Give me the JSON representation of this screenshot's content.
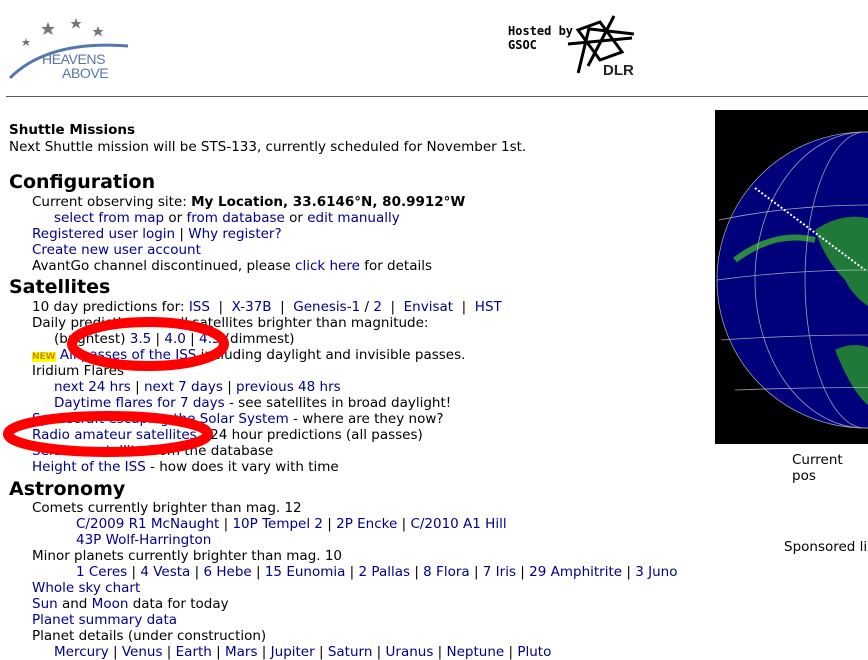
{
  "header": {
    "logo_line1": "HEAVENS",
    "logo_line2": "ABOVE",
    "hosted_by": "Hosted by GSOC",
    "dlr": "DLR"
  },
  "shuttle": {
    "heading": "Shuttle Missions",
    "text": "Next Shuttle mission will be STS-133, currently scheduled for November 1st."
  },
  "configuration": {
    "heading": "Configuration",
    "site_prefix": "Current observing site: ",
    "site_value": "My Location, 33.6146°N, 80.9912°W",
    "select_from_map": "select from map",
    "or1": " or ",
    "from_database": "from database",
    "or2": " or ",
    "edit_manually": "edit manually",
    "registered_login": "Registered user login",
    "sep": " | ",
    "why_register": "Why register?",
    "create_account": "Create new user account",
    "avantgo_prefix": "AvantGo channel discontinued, please ",
    "click_here": "click here",
    "avantgo_suffix": " for details"
  },
  "satellites": {
    "heading": "Satellites",
    "ten_day_prefix": "10 day predictions for: ",
    "iss": "ISS",
    "x37b": "X-37B",
    "genesis1": "Genesis-1",
    "slash": " / ",
    "genesis2": "2",
    "envisat": "Envisat",
    "hst": "HST",
    "daily_text": "Daily predictions for all satellites brighter than magnitude:",
    "brightest": "(brightest)",
    "mag35": "3.5",
    "mag40": "4.0",
    "mag45": "4.5",
    "dimmest": " (dimmest)",
    "new_badge": "NEW",
    "all_passes_iss": "All passes of the ISS",
    "all_passes_suffix": " including daylight and invisible passes.",
    "iridium": "Iridium Flares",
    "next24": "next 24 hrs",
    "next7": "next 7 days",
    "prev48": "previous 48 hrs",
    "daytime_flares": "Daytime flares for 7 days",
    "daytime_suffix": " - see satellites in broad daylight!",
    "spacecraft": "Spacecraft escaping",
    "solar_system": "the Solar System",
    "solar_suffix": " - where are they now?",
    "radio": "Radio amateur satellites",
    "radio_suffix": " - 24 hour predictions (all passes)",
    "select_sat": "Select",
    "select_sat_suffix": " a satellite from the database",
    "height_iss": "Height of the ISS",
    "height_suffix": " - how does it vary with time"
  },
  "astronomy": {
    "heading": "Astronomy",
    "comets_text": "Comets currently brighter than mag. 12",
    "comets": [
      "C/2009 R1 McNaught",
      "10P Tempel 2",
      "2P Encke",
      "C/2010 A1 Hill"
    ],
    "comet_extra": "43P Wolf-Harrington",
    "minor_text": "Minor planets currently brighter than mag. 10",
    "minor": [
      "1 Ceres",
      "4 Vesta",
      "6 Hebe",
      "15 Eunomia",
      "2 Pallas",
      "8 Flora",
      "7 Iris",
      "29 Amphitrite",
      "3 Juno"
    ],
    "whole_sky": "Whole sky chart",
    "sun": "Sun",
    "and": " and ",
    "moon": "Moon",
    "data_today": " data for today",
    "planet_summary": "Planet summary data",
    "planet_details": "Planet details (under construction)",
    "planets": [
      "Mercury",
      "Venus",
      "Earth",
      "Mars",
      "Jupiter",
      "Saturn",
      "Uranus",
      "Neptune",
      "Pluto"
    ]
  },
  "sidebar": {
    "globe_caption": "Current pos",
    "sponsored": "Sponsored li"
  },
  "colors": {
    "link": "#00008b",
    "annotation": "#ff0000",
    "ocean": "#00007a",
    "land": "#1f7a3a"
  }
}
